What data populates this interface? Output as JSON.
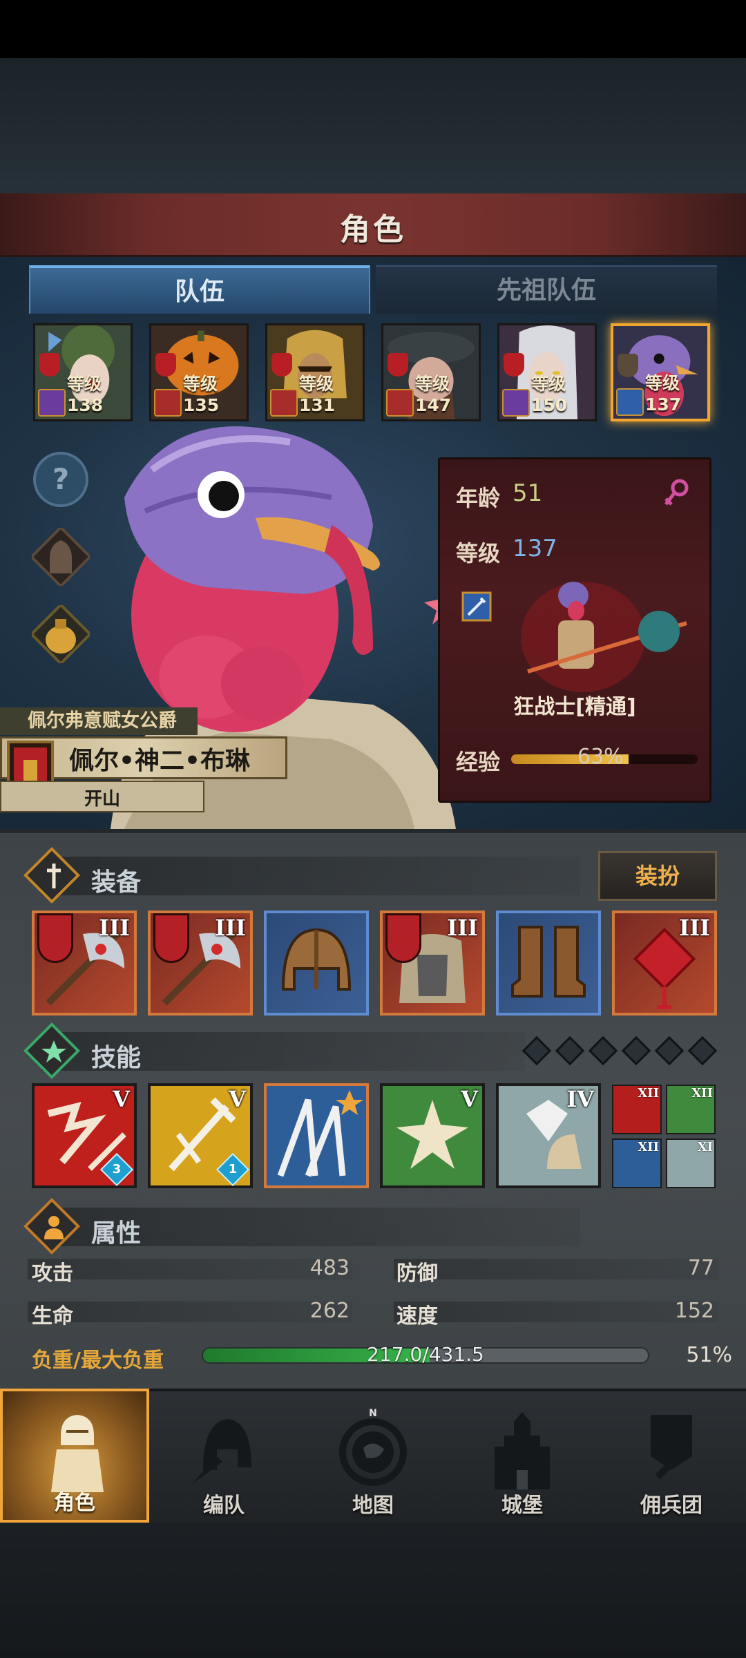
{
  "screen": {
    "title": "角色",
    "tabs": [
      {
        "label": "队伍",
        "active": true
      },
      {
        "label": "先祖队伍",
        "active": false
      }
    ]
  },
  "party": [
    {
      "level_label": "等级138",
      "class_icon": "staff-icon",
      "selected": false
    },
    {
      "level_label": "等级135",
      "class_icon": "horse-icon",
      "selected": false
    },
    {
      "level_label": "等级131",
      "class_icon": "horse-icon",
      "selected": false
    },
    {
      "level_label": "等级147",
      "class_icon": "horse-icon",
      "selected": false
    },
    {
      "level_label": "等级150",
      "class_icon": "staff-icon",
      "selected": false
    },
    {
      "level_label": "等级137",
      "class_icon": "sword-icon",
      "selected": true
    }
  ],
  "hero": {
    "title": "佩尔弗意赋女公爵",
    "name": "佩尔•神二•布琳",
    "subtitle": "开山",
    "stats": {
      "age_label": "年龄",
      "age": "51",
      "gender_icon": "female-icon",
      "level_label": "等级",
      "level": "137",
      "class_name": "狂战士[精通]",
      "exp_label": "经验",
      "exp_pct_text": "63%",
      "exp_fraction": 0.63
    }
  },
  "equipment": {
    "title": "装备",
    "dress_button": "装扮",
    "slots": [
      {
        "tier": "III",
        "rarity": "orange",
        "banner": true
      },
      {
        "tier": "III",
        "rarity": "orange",
        "banner": true
      },
      {
        "tier": "",
        "rarity": "blue",
        "banner": false
      },
      {
        "tier": "III",
        "rarity": "orange",
        "banner": true
      },
      {
        "tier": "",
        "rarity": "blue",
        "banner": false
      },
      {
        "tier": "III",
        "rarity": "orange",
        "banner": false
      }
    ]
  },
  "skills": {
    "title": "技能",
    "main": [
      {
        "tier": "V",
        "gem": "3",
        "color": "#c0201c"
      },
      {
        "tier": "V",
        "gem": "1",
        "color": "#d6a31d"
      },
      {
        "tier": "",
        "gem": "",
        "color": "#2e5e98"
      },
      {
        "tier": "V",
        "gem": "",
        "color": "#3f8a3c"
      },
      {
        "tier": "IV",
        "gem": "",
        "color": "#8fa7a8"
      }
    ],
    "mini": [
      {
        "tier": "XII",
        "color": "#b41f1d"
      },
      {
        "tier": "XII",
        "color": "#3f8a3c"
      },
      {
        "tier": "XII",
        "color": "#2e5e98"
      },
      {
        "tier": "XI",
        "color": "#8fa7a8"
      }
    ]
  },
  "attributes": {
    "title": "属性",
    "attack_label": "攻击",
    "attack": "483",
    "defense_label": "防御",
    "defense": "77",
    "hp_label": "生命",
    "hp": "262",
    "speed_label": "速度",
    "speed": "152",
    "load_label": "负重/最大负重",
    "load_text": "217.0/431.5",
    "load_pct": "51%",
    "load_fraction": 0.51
  },
  "nav": [
    {
      "label": "角色",
      "icon": "knight-icon",
      "active": true
    },
    {
      "label": "编队",
      "icon": "helmet-icon",
      "active": false
    },
    {
      "label": "地图",
      "icon": "compass-icon",
      "active": false
    },
    {
      "label": "城堡",
      "icon": "castle-icon",
      "active": false
    },
    {
      "label": "佣兵团",
      "icon": "banner-icon",
      "active": false
    }
  ],
  "colors": {
    "accent": "#f2a632",
    "title_banner": "#7a3430",
    "tab_active": "#3c6a95",
    "load_bar": "#38b34a",
    "exp_bar": "#f0c04a"
  }
}
